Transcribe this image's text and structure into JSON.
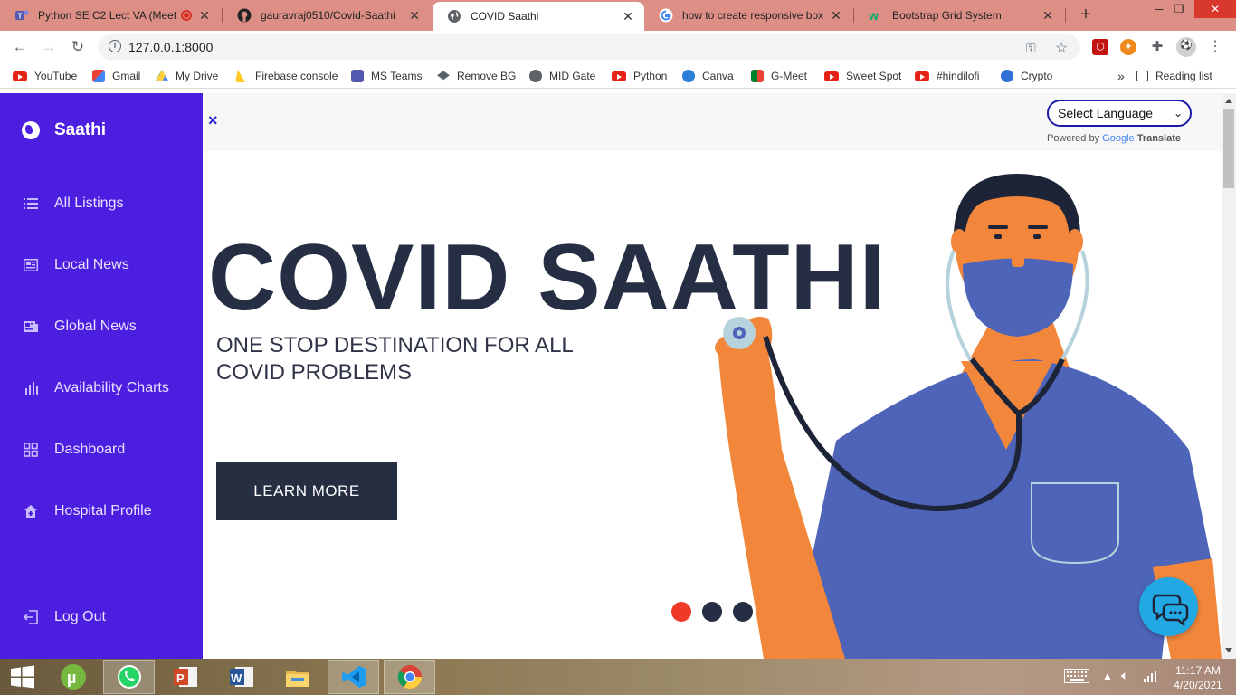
{
  "browser": {
    "tabs": [
      {
        "title": "Python SE C2 Lect VA (Meet",
        "icon": "teams-icon"
      },
      {
        "title": "gauravraj0510/Covid-Saathi",
        "icon": "github-icon"
      },
      {
        "title": "COVID Saathi",
        "icon": "globe-icon"
      },
      {
        "title": "how to create responsive box us",
        "icon": "google-icon"
      },
      {
        "title": "Bootstrap Grid System",
        "icon": "w3schools-icon"
      }
    ],
    "url": "127.0.0.1:8000",
    "bookmarks": [
      {
        "label": "YouTube"
      },
      {
        "label": "Gmail"
      },
      {
        "label": "My Drive"
      },
      {
        "label": "Firebase console"
      },
      {
        "label": "MS Teams"
      },
      {
        "label": "Remove BG"
      },
      {
        "label": "MID Gate"
      },
      {
        "label": "Python"
      },
      {
        "label": "Canva"
      },
      {
        "label": "G-Meet"
      },
      {
        "label": "Sweet Spot"
      },
      {
        "label": "#hindilofi"
      },
      {
        "label": "Crypto"
      }
    ],
    "reading_list": "Reading list",
    "more": "»"
  },
  "sidebar": {
    "brand": "Saathi",
    "items": [
      {
        "label": "All Listings",
        "icon": "list-icon"
      },
      {
        "label": "Local News",
        "icon": "newspaper-icon"
      },
      {
        "label": "Global News",
        "icon": "news-icon"
      },
      {
        "label": "Availability Charts",
        "icon": "bar-chart-icon"
      },
      {
        "label": "Dashboard",
        "icon": "grid-icon"
      },
      {
        "label": "Hospital Profile",
        "icon": "hospital-icon"
      }
    ],
    "logout": "Log Out"
  },
  "translate": {
    "close": "×",
    "select_label": "Select Language",
    "powered_by": "Powered by",
    "google": "Google",
    "translate": "Translate"
  },
  "hero": {
    "title": "COVID SAATHI",
    "subtitle": "ONE STOP DESTINATION FOR ALL COVID PROBLEMS",
    "cta": "LEARN MORE",
    "carousel_active_index": 0,
    "carousel_count": 3
  },
  "colors": {
    "sidebar": "#4c1fe0",
    "title": "#252e42",
    "dot_active": "#f03a28",
    "dot": "#252e42",
    "chat": "#22a8e2"
  },
  "taskbar": {
    "apps": [
      "windows-icon",
      "utorrent-icon",
      "whatsapp-icon",
      "powerpoint-icon",
      "word-icon",
      "file-explorer-icon",
      "vscode-icon",
      "chrome-icon"
    ],
    "time": "11:17 AM",
    "date": "4/20/2021"
  }
}
